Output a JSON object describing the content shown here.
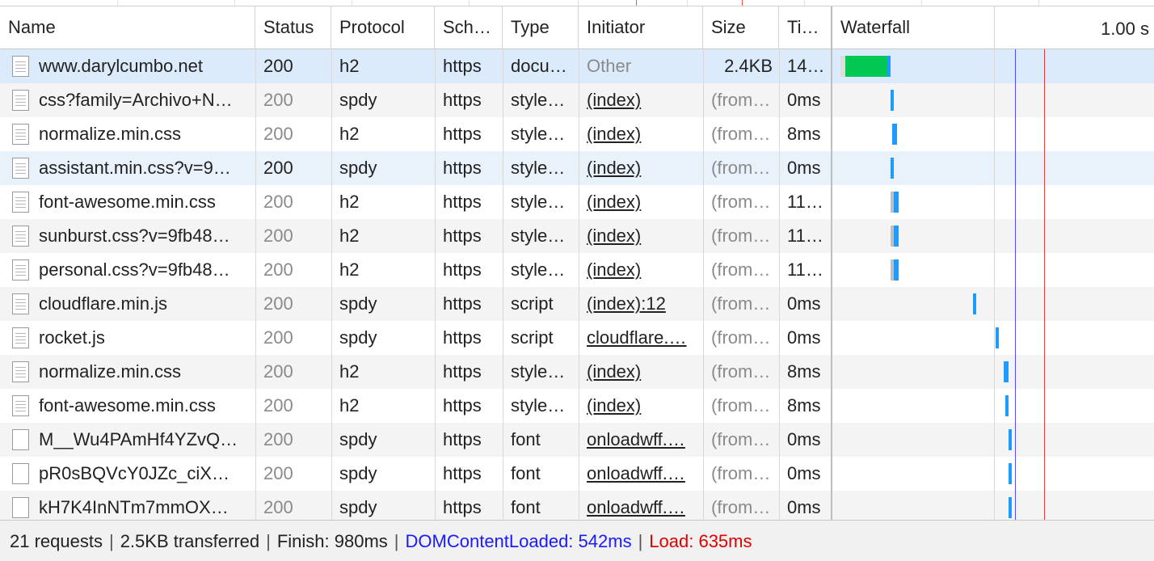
{
  "columns": {
    "name": "Name",
    "status": "Status",
    "protocol": "Protocol",
    "scheme": "Sch…",
    "type": "Type",
    "initiator": "Initiator",
    "size": "Size",
    "time": "Ti…",
    "waterfall": "Waterfall",
    "waterfall_scale": "1.00 s"
  },
  "rows": [
    {
      "name": "www.darylcumbo.net",
      "status": "200",
      "protocol": "h2",
      "scheme": "https",
      "type": "docu…",
      "initiator": "Other",
      "size": "2.4KB",
      "time": "14…",
      "icon": "document-icon"
    },
    {
      "name": "css?family=Archivo+N…",
      "status": "200",
      "protocol": "spdy",
      "scheme": "https",
      "type": "style…",
      "initiator": "(index)",
      "size": "(from…",
      "time": "0ms",
      "icon": "document-icon"
    },
    {
      "name": "normalize.min.css",
      "status": "200",
      "protocol": "h2",
      "scheme": "https",
      "type": "style…",
      "initiator": "(index)",
      "size": "(from…",
      "time": "8ms",
      "icon": "document-icon"
    },
    {
      "name": "assistant.min.css?v=9…",
      "status": "200",
      "protocol": "spdy",
      "scheme": "https",
      "type": "style…",
      "initiator": "(index)",
      "size": "(from…",
      "time": "0ms",
      "icon": "document-icon"
    },
    {
      "name": "font-awesome.min.css",
      "status": "200",
      "protocol": "h2",
      "scheme": "https",
      "type": "style…",
      "initiator": "(index)",
      "size": "(from…",
      "time": "11…",
      "icon": "document-icon"
    },
    {
      "name": "sunburst.css?v=9fb48…",
      "status": "200",
      "protocol": "h2",
      "scheme": "https",
      "type": "style…",
      "initiator": "(index)",
      "size": "(from…",
      "time": "11…",
      "icon": "document-icon"
    },
    {
      "name": "personal.css?v=9fb48…",
      "status": "200",
      "protocol": "h2",
      "scheme": "https",
      "type": "style…",
      "initiator": "(index)",
      "size": "(from…",
      "time": "11…",
      "icon": "document-icon"
    },
    {
      "name": "cloudflare.min.js",
      "status": "200",
      "protocol": "spdy",
      "scheme": "https",
      "type": "script",
      "initiator": "(index):12",
      "size": "(from…",
      "time": "0ms",
      "icon": "document-icon"
    },
    {
      "name": "rocket.js",
      "status": "200",
      "protocol": "spdy",
      "scheme": "https",
      "type": "script",
      "initiator": "cloudflare.…",
      "size": "(from…",
      "time": "0ms",
      "icon": "document-icon"
    },
    {
      "name": "normalize.min.css",
      "status": "200",
      "protocol": "h2",
      "scheme": "https",
      "type": "style…",
      "initiator": "(index)",
      "size": "(from…",
      "time": "8ms",
      "icon": "document-icon"
    },
    {
      "name": "font-awesome.min.css",
      "status": "200",
      "protocol": "h2",
      "scheme": "https",
      "type": "style…",
      "initiator": "(index)",
      "size": "(from…",
      "time": "8ms",
      "icon": "document-icon"
    },
    {
      "name": "M__Wu4PAmHf4YZvQ…",
      "status": "200",
      "protocol": "spdy",
      "scheme": "https",
      "type": "font",
      "initiator": "onloadwff.…",
      "size": "(from…",
      "time": "0ms",
      "icon": "font-file-icon"
    },
    {
      "name": "pR0sBQVcY0JZc_ciX…",
      "status": "200",
      "protocol": "spdy",
      "scheme": "https",
      "type": "font",
      "initiator": "onloadwff.…",
      "size": "(from…",
      "time": "0ms",
      "icon": "font-file-icon"
    },
    {
      "name": "kH7K4InNTm7mmOX…",
      "status": "200",
      "protocol": "spdy",
      "scheme": "https",
      "type": "font",
      "initiator": "onloadwff.…",
      "size": "(from…",
      "time": "0ms",
      "icon": "font-file-icon"
    }
  ],
  "footer": {
    "requests": "21 requests",
    "transferred": "2.5KB transferred",
    "finish": "Finish: 980ms",
    "dom_content_loaded": "DOMContentLoaded: 542ms",
    "load": "Load: 635ms"
  },
  "colors": {
    "dom_content_loaded": "#1a1aff",
    "load": "#e00000",
    "waterfall_receiving": "#1e9bff",
    "waterfall_waiting": "#00c853",
    "selected_row": "#dcebfb"
  }
}
